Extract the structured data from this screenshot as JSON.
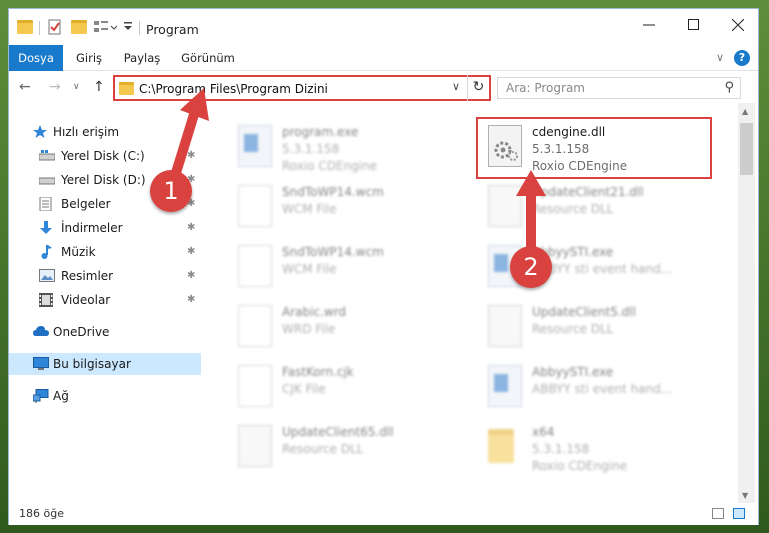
{
  "window": {
    "title": "Program",
    "controls": {
      "minimize": "–",
      "maximize": "☐",
      "close": "✕"
    }
  },
  "ribbon": {
    "tabs": [
      "Dosya",
      "Giriş",
      "Paylaş",
      "Görünüm"
    ],
    "expand_glyph": "∨",
    "help_glyph": "?"
  },
  "nav": {
    "back": "←",
    "forward": "→",
    "recent": "∨",
    "up": "↑",
    "address": "C:\\Program Files\\Program Dizini",
    "address_drop": "∨",
    "refresh": "↻",
    "search_placeholder": "Ara: Program",
    "search_glyph": "⚲"
  },
  "sidebar": {
    "items": [
      {
        "label": "Hızlı erişim",
        "icon": "star-icon",
        "pinned": false
      },
      {
        "label": "Yerel Disk (C:)",
        "icon": "drive-icon",
        "pinned": true
      },
      {
        "label": "Yerel Disk (D:)",
        "icon": "drive-icon",
        "pinned": true
      },
      {
        "label": "Belgeler",
        "icon": "documents-icon",
        "pinned": true
      },
      {
        "label": "İndirmeler",
        "icon": "download-icon",
        "pinned": true
      },
      {
        "label": "Müzik",
        "icon": "music-icon",
        "pinned": true
      },
      {
        "label": "Resimler",
        "icon": "pictures-icon",
        "pinned": true
      },
      {
        "label": "Videolar",
        "icon": "videos-icon",
        "pinned": true
      },
      {
        "label": "OneDrive",
        "icon": "cloud-icon",
        "pinned": false
      },
      {
        "label": "Bu bilgisayar",
        "icon": "computer-icon",
        "pinned": false
      },
      {
        "label": "Ağ",
        "icon": "network-icon",
        "pinned": false
      }
    ],
    "pin_glyph": "📌"
  },
  "files": {
    "left": [
      {
        "name": "program.exe",
        "line2": "5.3.1.158",
        "line3": "Roxio CDEngine",
        "icon": "exe-file-icon"
      },
      {
        "name": "SndToWP14.wcm",
        "line2": "WCM File",
        "line3": "",
        "icon": "document-icon"
      },
      {
        "name": "SndToWP14.wcm",
        "line2": "WCM File",
        "line3": "",
        "icon": "document-icon"
      },
      {
        "name": "Arabic.wrd",
        "line2": "WRD File",
        "line3": "",
        "icon": "document-icon"
      },
      {
        "name": "FastKorn.cjk",
        "line2": "CJK File",
        "line3": "",
        "icon": "document-icon"
      },
      {
        "name": "UpdateClient65.dll",
        "line2": "Resource DLL",
        "line3": "",
        "icon": "dll-file-icon"
      }
    ],
    "right": [
      {
        "name": "cdengine.dll",
        "line2": "5.3.1.158",
        "line3": "Roxio CDEngine",
        "icon": "dll-file-icon"
      },
      {
        "name": "UpdateClient21.dll",
        "line2": "Resource DLL",
        "line3": "",
        "icon": "dll-file-icon"
      },
      {
        "name": "AbbyySTI.exe",
        "line2": "ABBYY sti event hand...",
        "line3": "",
        "icon": "exe-file-icon"
      },
      {
        "name": "UpdateClient5.dll",
        "line2": "Resource DLL",
        "line3": "",
        "icon": "dll-file-icon"
      },
      {
        "name": "AbbyySTI.exe",
        "line2": "ABBYY sti event hand...",
        "line3": "",
        "icon": "exe-file-icon"
      },
      {
        "name": "x64",
        "line2": "5.3.1.158",
        "line3": "Roxio CDEngine",
        "icon": "folder-icon"
      }
    ]
  },
  "status": {
    "count": "186 öğe"
  },
  "annotations": {
    "callout_1": "1",
    "callout_2": "2"
  },
  "colors": {
    "accent": "#1979ca",
    "highlight": "#d9423f",
    "selected": "#cce8ff"
  }
}
